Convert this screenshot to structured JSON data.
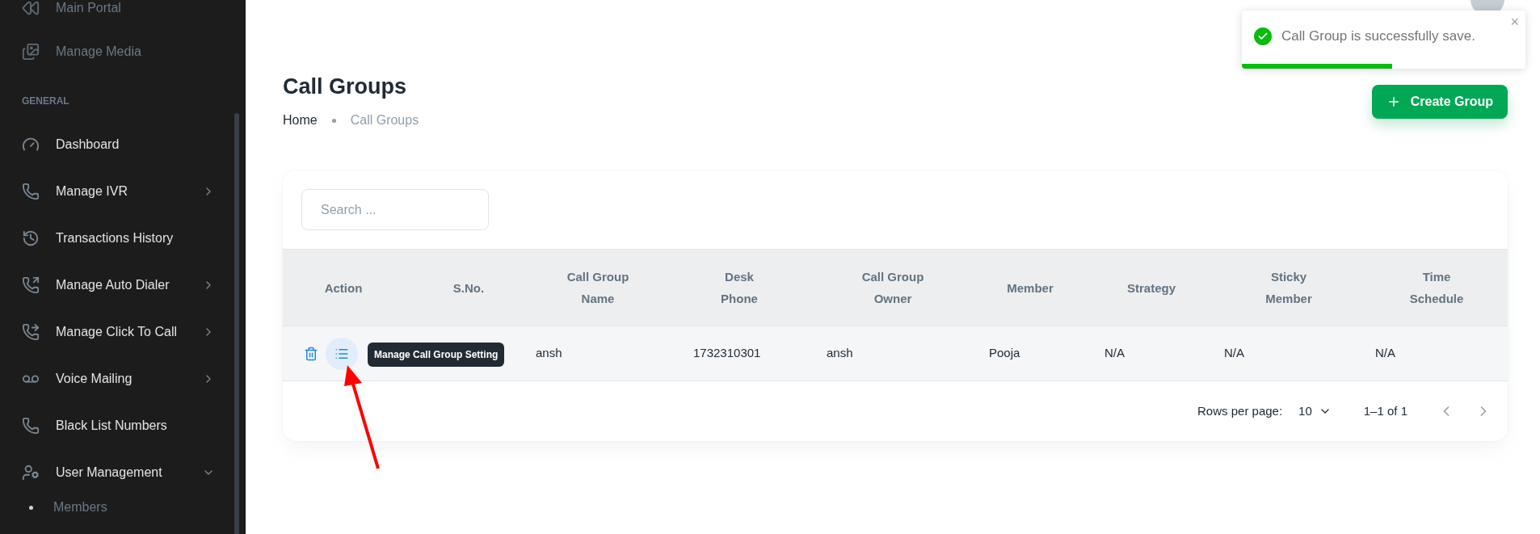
{
  "sidebar": {
    "top_items": [
      {
        "label": "Main Portal"
      },
      {
        "label": "Manage Media"
      }
    ],
    "section_title": "GENERAL",
    "items": [
      {
        "label": "Dashboard",
        "kind": "link"
      },
      {
        "label": "Manage IVR",
        "kind": "menu",
        "expanded": false
      },
      {
        "label": "Transactions History",
        "kind": "link"
      },
      {
        "label": "Manage Auto Dialer",
        "kind": "menu",
        "expanded": false
      },
      {
        "label": "Manage Click To Call",
        "kind": "menu",
        "expanded": false
      },
      {
        "label": "Voice Mailing",
        "kind": "menu",
        "expanded": false
      },
      {
        "label": "Black List Numbers",
        "kind": "link"
      },
      {
        "label": "User Management",
        "kind": "menu",
        "expanded": true,
        "children": [
          {
            "label": "Members"
          }
        ]
      }
    ]
  },
  "page": {
    "title": "Call Groups",
    "breadcrumb": [
      "Home",
      "Call Groups"
    ],
    "create_button": "Create Group"
  },
  "toast": {
    "message": "Call Group is successfully save.",
    "close": "×",
    "level": 0.53
  },
  "table": {
    "search": {
      "placeholder": "Search ..."
    },
    "columns": [
      "Action",
      "S.No.",
      "Call Group Name",
      "Desk Phone",
      "Call Group Owner",
      "Member",
      "Strategy",
      "Sticky Member",
      "Time Schedule"
    ],
    "rows": [
      {
        "cells": [
          "",
          "",
          "ansh",
          "1732310301",
          "ansh",
          "Pooja",
          "N/A",
          "N/A",
          "N/A"
        ],
        "tooltip": "Manage Call Group Setting"
      }
    ],
    "pagination": {
      "rows_per_page_label": "Rows per page:",
      "rows_per_page": "10",
      "range": "1–1 of 1"
    }
  }
}
